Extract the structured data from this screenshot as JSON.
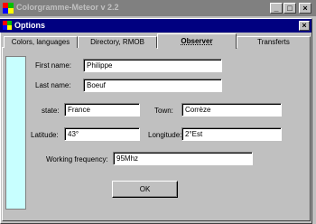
{
  "background_window": {
    "title": "Colorgramme-Meteor v 2.2",
    "buttons": {
      "minimize": "_",
      "maximize": "□",
      "close": "×"
    }
  },
  "dialog": {
    "title": "Options",
    "close_glyph": "×",
    "tabs": [
      {
        "label": "Colors, languages"
      },
      {
        "label": "Directory, RMOB"
      },
      {
        "label": "Observer",
        "active": true
      },
      {
        "label": "Transferts"
      }
    ],
    "form": {
      "first_name_label": "First name:",
      "first_name_value": "Philippe",
      "last_name_label": "Last name:",
      "last_name_value": "Boeuf",
      "state_label": "state:",
      "state_value": "France",
      "town_label": "Town:",
      "town_value": "Corrèze",
      "latitude_label": "Latitude:",
      "latitude_value": "43°",
      "longitude_label": "Longitude:",
      "longitude_value": "2°Est",
      "frequency_label": "Working frequency:",
      "frequency_value": "95Mhz"
    },
    "ok_label": "OK"
  },
  "colors": {
    "title_active": "#000080",
    "title_inactive": "#808080",
    "face": "#c0c0c0",
    "side_strip": "#c8ffff"
  },
  "icons": [
    "app-icon",
    "minimize-icon",
    "maximize-icon",
    "close-icon"
  ]
}
